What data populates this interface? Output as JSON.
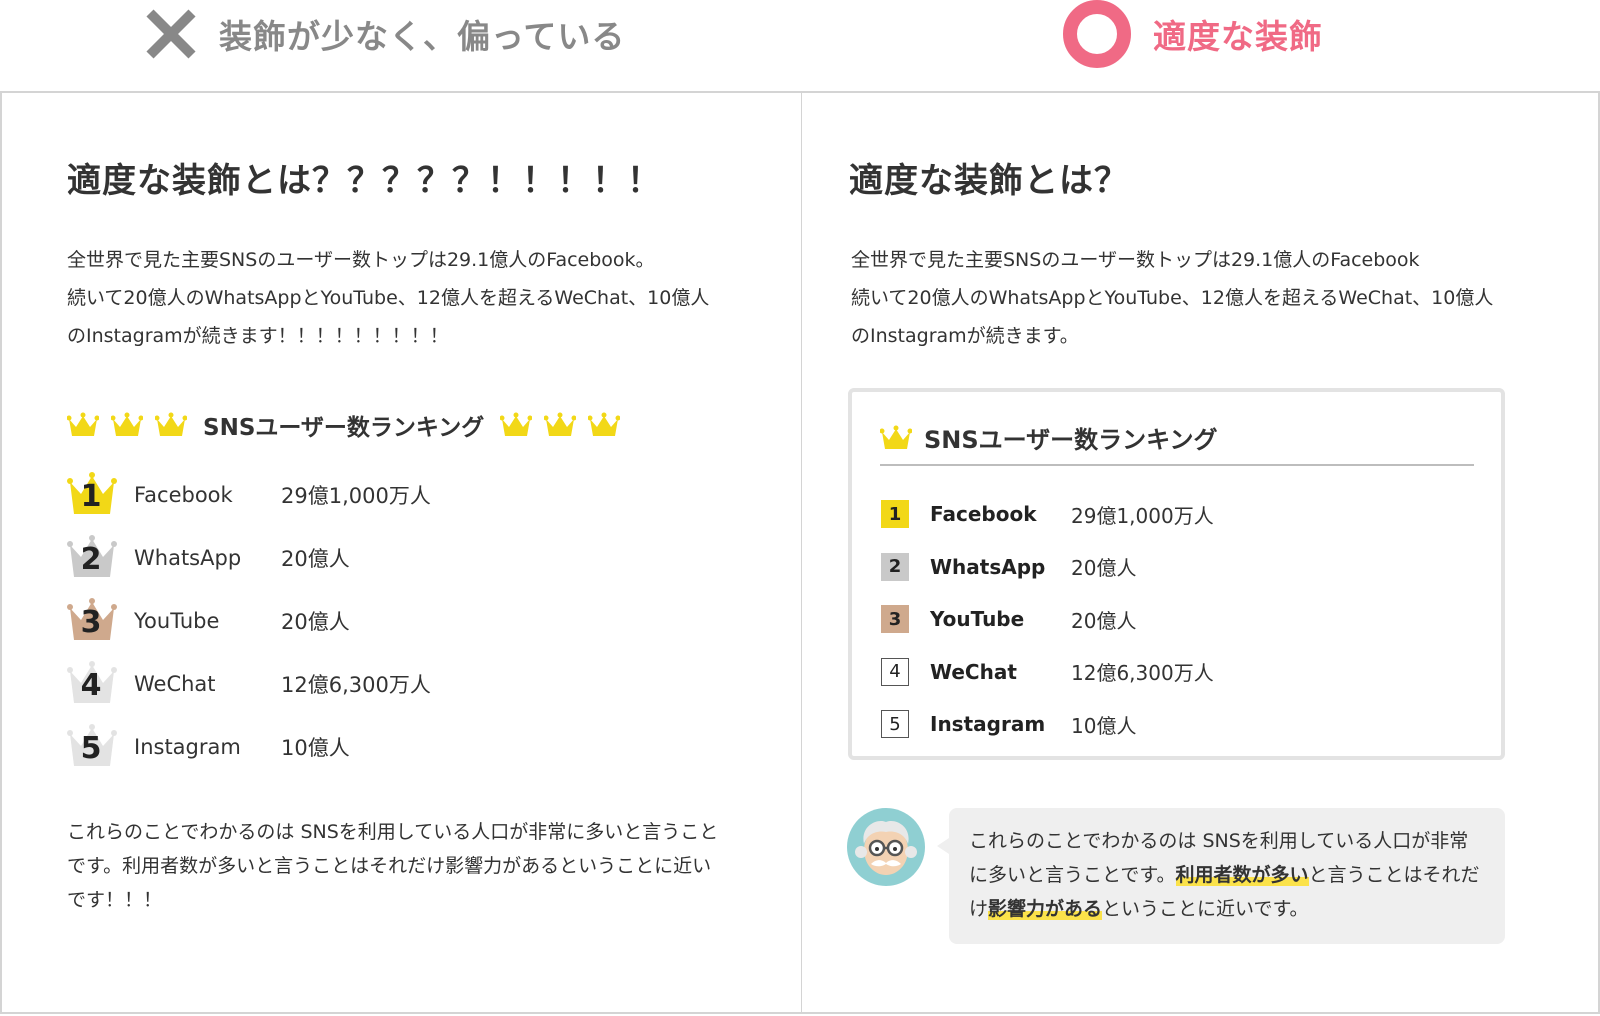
{
  "header": {
    "bad_label": "装飾が少なく、偏っている",
    "good_label": "適度な装飾",
    "bad_icon": "cross-icon",
    "good_icon": "circle-icon",
    "bad_color": "#888888",
    "good_color": "#f06a85"
  },
  "left": {
    "title": "適度な装飾とは？？？？？！！！！！",
    "intro_lines": [
      "全世界で見た主要SNSのユーザー数トップは29.1億人のFacebook。",
      "続いて20億人のWhatsAppとYouTube、12億人を超えるWeChat、10億人",
      "のInstagramが続きます！！！！！！！！！"
    ],
    "ranking_title": "SNSユーザー数ランキング",
    "ranking": [
      {
        "rank": "1",
        "name": "Facebook",
        "users": "29億1,000万人",
        "color": "#f2d817"
      },
      {
        "rank": "2",
        "name": "WhatsApp",
        "users": "20億人",
        "color": "#c9c9c9"
      },
      {
        "rank": "3",
        "name": "YouTube",
        "users": "20億人",
        "color": "#cfa98d"
      },
      {
        "rank": "4",
        "name": "WeChat",
        "users": "12億6,300万人",
        "color": "#e3e3e3"
      },
      {
        "rank": "5",
        "name": "Instagram",
        "users": "10億人",
        "color": "#e3e3e3"
      }
    ],
    "outro": "これらのことでわかるのは SNSを利用している人口が非常に多いと言うことです。利用者数が多いと言うことはそれだけ影響力があるということに近いです！！！"
  },
  "right": {
    "title": "適度な装飾とは？",
    "intro_lines": [
      "全世界で見た主要SNSのユーザー数トップは29.1億人のFacebook",
      "続いて20億人のWhatsAppとYouTube、12億人を超えるWeChat、10億人",
      "のInstagramが続きます。"
    ],
    "ranking_title": "SNSユーザー数ランキング",
    "ranking": [
      {
        "rank": "1",
        "name": "Facebook",
        "users": "29億1,000万人",
        "color": "#f2d817"
      },
      {
        "rank": "2",
        "name": "WhatsApp",
        "users": "20億人",
        "color": "#c9c9c9"
      },
      {
        "rank": "3",
        "name": "YouTube",
        "users": "20億人",
        "color": "#cfa98d"
      },
      {
        "rank": "4",
        "name": "WeChat",
        "users": "12億6,300万人",
        "color": "#ffffff"
      },
      {
        "rank": "5",
        "name": "Instagram",
        "users": "10億人",
        "color": "#ffffff"
      }
    ],
    "bubble": {
      "part1": "これらのことでわかるのは SNSを利用している人口が非常に多いと言うことです。",
      "highlight1": "利用者数が多い",
      "part2": "と言うことはそれだけ",
      "highlight2": "影響力がある",
      "part3": "ということに近いです。"
    },
    "avatar_icon": "professor-avatar-icon"
  },
  "crown_color": "#f2d817"
}
